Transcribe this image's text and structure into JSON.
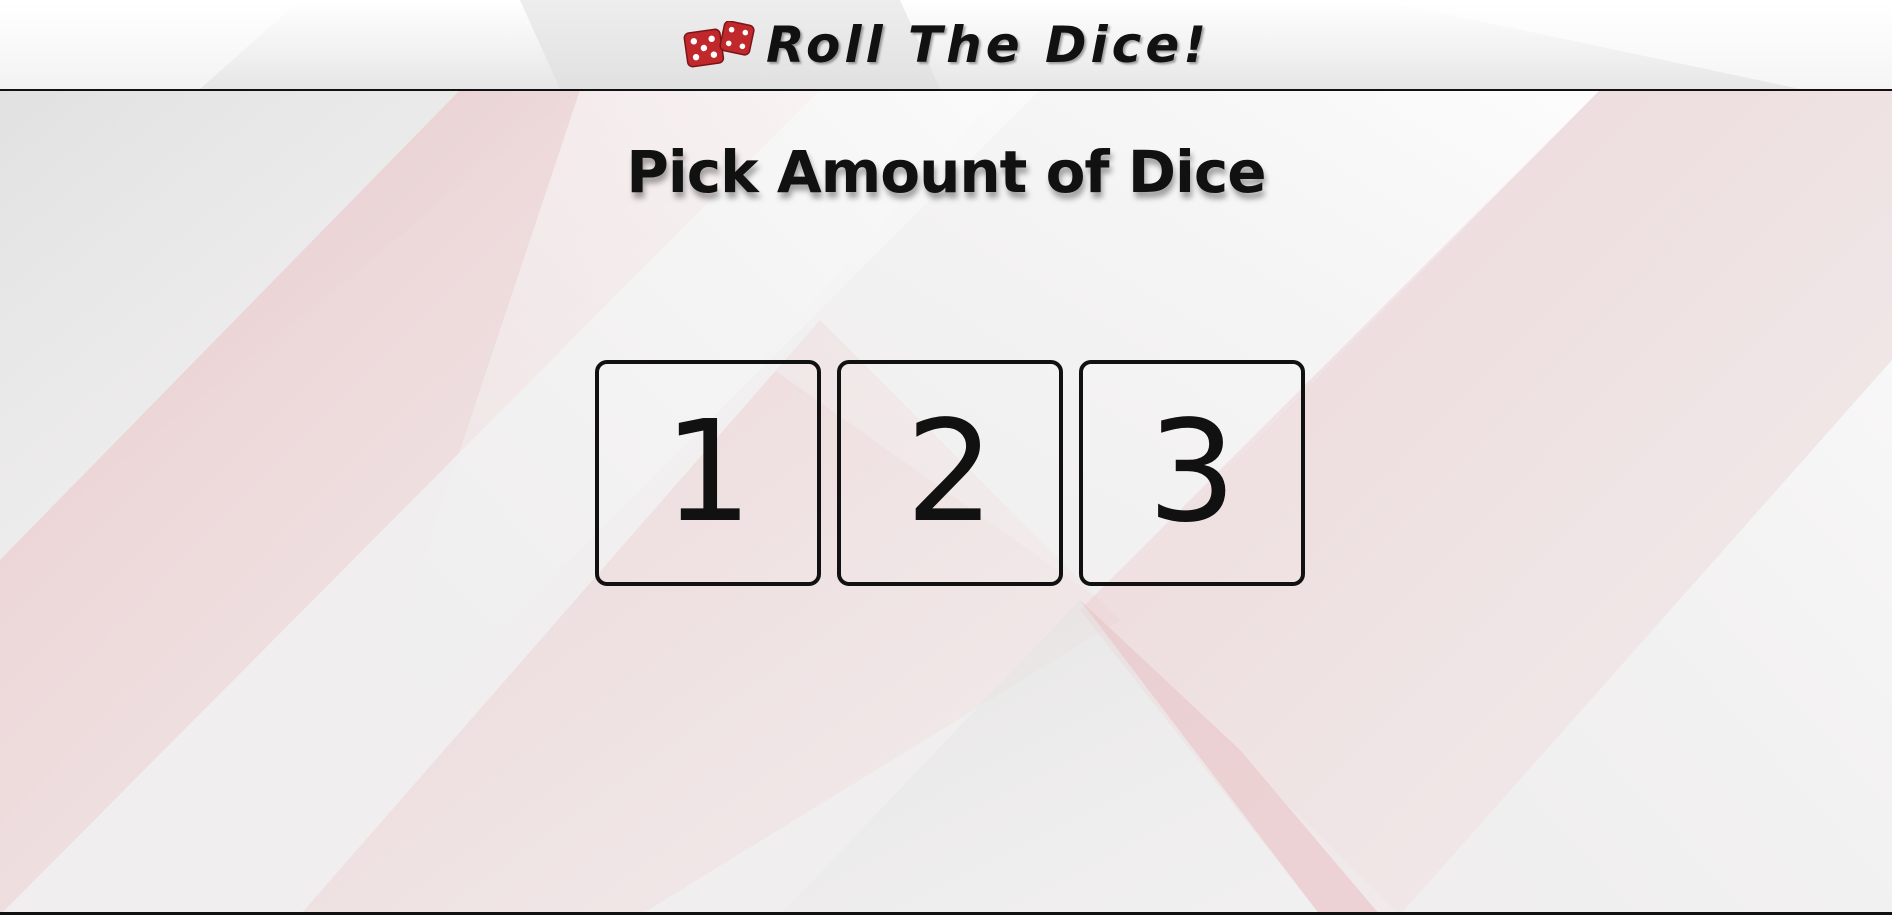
{
  "header": {
    "title": "Roll The Dice!",
    "logo_icon": "dice-pair-icon",
    "logo_color": "#c0282b"
  },
  "main": {
    "title": "Pick Amount of Dice",
    "choices": [
      {
        "label": "1"
      },
      {
        "label": "2"
      },
      {
        "label": "3"
      }
    ]
  },
  "theme": {
    "accent": "#d9a9ad",
    "background": "#f2f0f0",
    "border": "#111111"
  }
}
